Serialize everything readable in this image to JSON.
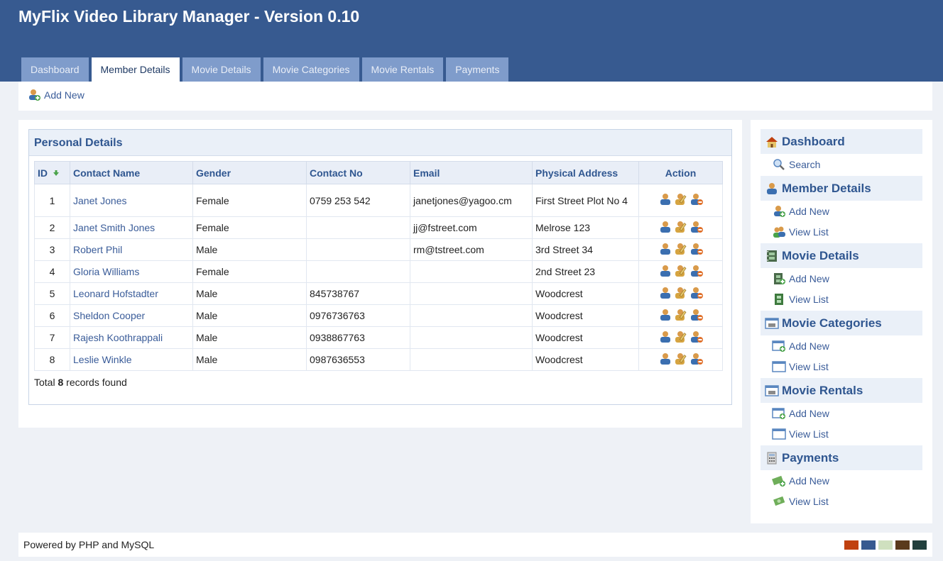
{
  "app": {
    "title": "MyFlix Video Library Manager - Version 0.10"
  },
  "tabs": [
    {
      "label": "Dashboard",
      "active": false
    },
    {
      "label": "Member Details",
      "active": true
    },
    {
      "label": "Movie Details",
      "active": false
    },
    {
      "label": "Movie Categories",
      "active": false
    },
    {
      "label": "Movie Rentals",
      "active": false
    },
    {
      "label": "Payments",
      "active": false
    }
  ],
  "subbar": {
    "add_new_label": "Add New",
    "icon": "add-user-icon"
  },
  "panel": {
    "title": "Personal Details",
    "columns": [
      "ID",
      "Contact Name",
      "Gender",
      "Contact No",
      "Email",
      "Physical Address",
      "Action"
    ],
    "sort_icon": "sort-arrow-down-icon",
    "rows": [
      {
        "id": "1",
        "name": "Janet Jones",
        "gender": "Female",
        "contact": "0759 253 542",
        "email": "janetjones@yagoo.cm",
        "address": "First Street Plot No 4"
      },
      {
        "id": "2",
        "name": "Janet Smith Jones",
        "gender": "Female",
        "contact": "",
        "email": "jj@fstreet.com",
        "address": "Melrose 123"
      },
      {
        "id": "3",
        "name": "Robert Phil",
        "gender": "Male",
        "contact": "",
        "email": "rm@tstreet.com",
        "address": "3rd Street 34"
      },
      {
        "id": "4",
        "name": "Gloria Williams",
        "gender": "Female",
        "contact": "",
        "email": "",
        "address": "2nd Street 23"
      },
      {
        "id": "5",
        "name": "Leonard Hofstadter",
        "gender": "Male",
        "contact": "845738767",
        "email": "",
        "address": "Woodcrest"
      },
      {
        "id": "6",
        "name": "Sheldon Cooper",
        "gender": "Male",
        "contact": "0976736763",
        "email": "",
        "address": "Woodcrest"
      },
      {
        "id": "7",
        "name": "Rajesh Koothrappali",
        "gender": "Male",
        "contact": "0938867763",
        "email": "",
        "address": "Woodcrest"
      },
      {
        "id": "8",
        "name": "Leslie Winkle",
        "gender": "Male",
        "contact": "0987636553",
        "email": "",
        "address": "Woodcrest"
      }
    ],
    "action_icons": [
      "view-user-icon",
      "edit-user-icon",
      "delete-user-icon"
    ],
    "total_prefix": "Total ",
    "total_count": "8",
    "total_suffix": " records found"
  },
  "sidebar": {
    "sections": [
      {
        "title": "Dashboard",
        "icon": "home-icon",
        "items": [
          {
            "label": "Search",
            "icon": "search-icon"
          }
        ]
      },
      {
        "title": "Member Details",
        "icon": "user-icon",
        "items": [
          {
            "label": "Add New",
            "icon": "add-user-icon"
          },
          {
            "label": "View List",
            "icon": "users-list-icon"
          }
        ]
      },
      {
        "title": "Movie Details",
        "icon": "film-icon",
        "items": [
          {
            "label": "Add New",
            "icon": "add-film-icon"
          },
          {
            "label": "View List",
            "icon": "film-list-icon"
          }
        ]
      },
      {
        "title": "Movie Categories",
        "icon": "category-icon",
        "items": [
          {
            "label": "Add New",
            "icon": "add-window-icon"
          },
          {
            "label": "View List",
            "icon": "window-icon"
          }
        ]
      },
      {
        "title": "Movie Rentals",
        "icon": "rental-icon",
        "items": [
          {
            "label": "Add New",
            "icon": "add-window-icon"
          },
          {
            "label": "View List",
            "icon": "window-icon"
          }
        ]
      },
      {
        "title": "Payments",
        "icon": "calculator-icon",
        "items": [
          {
            "label": "Add New",
            "icon": "add-money-icon"
          },
          {
            "label": "View List",
            "icon": "money-icon"
          }
        ]
      }
    ]
  },
  "footer": {
    "text": "Powered by PHP and MySQL",
    "swatches": [
      "#c0410f",
      "#375a90",
      "#cfe0bf",
      "#5a3a1c",
      "#22403e"
    ]
  }
}
